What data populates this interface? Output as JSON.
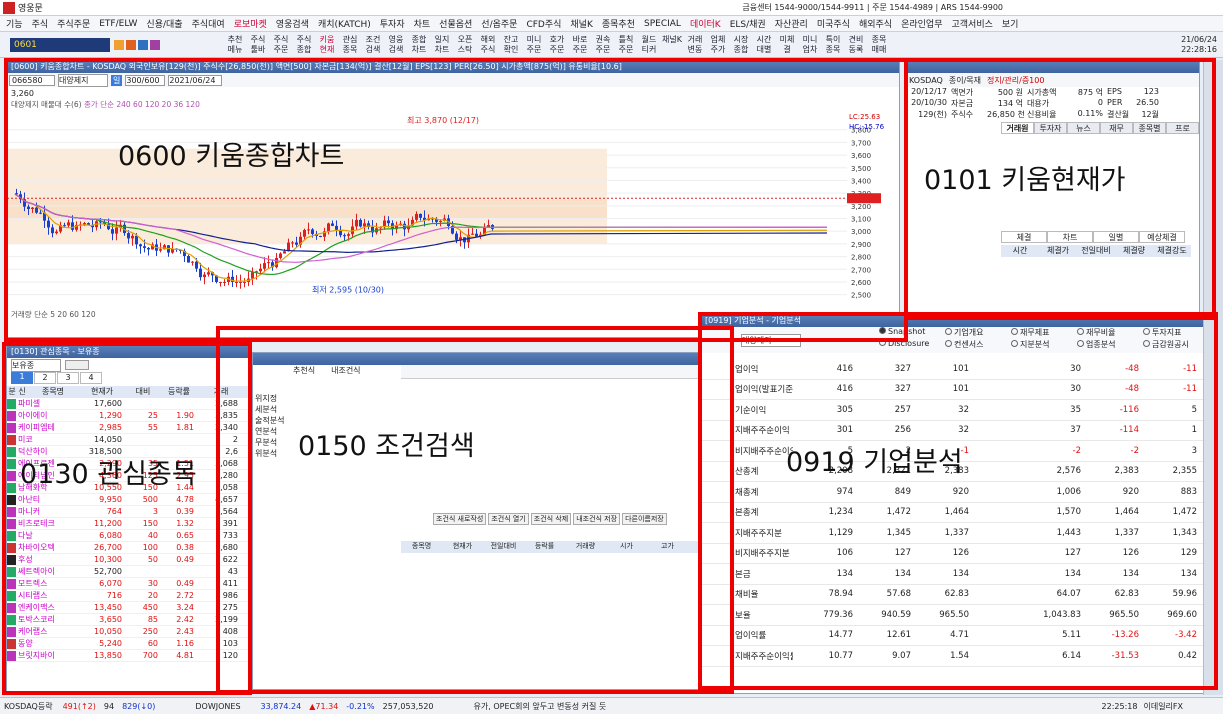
{
  "app": {
    "title": "영웅문",
    "center": "금융센터 1544-9000/1544-9911 | 주문 1544-4989 | ARS 1544-9900"
  },
  "menu": [
    "기능",
    "주식",
    "주식주문",
    "ETF/ELW",
    "신용/대출",
    "주식대여",
    "로보마켓",
    "영웅검색",
    "캐치(KATCH)",
    "투자자",
    "차트",
    "선물옵션",
    "선/옵주문",
    "CFD주식",
    "채널K",
    "종목추천",
    "SPECIAL",
    "데이터K",
    "ELS/채권",
    "자산관리",
    "미국주식",
    "해외주식",
    "온라인업무",
    "고객서비스",
    "보기"
  ],
  "toolbar": {
    "account": "0601",
    "buttons": [
      "추천메뉴",
      "주식툴바",
      "주식주문",
      "주식종합",
      "키움현재",
      "관심종목",
      "조건검색",
      "영웅검색",
      "종합차트",
      "일지차트",
      "오픈스탁",
      "해외주식",
      "잔고확인",
      "미니주문",
      "호가주문",
      "바로주문",
      "권속주문",
      "틀칙주문",
      "월드티커",
      "채널K",
      "거래변동",
      "업체주가",
      "시장종합",
      "시간대별",
      "미체결",
      "미니업차",
      "특이종목",
      "견비동록",
      "종목매매"
    ],
    "date": "21/06/24",
    "time": "22:28:16"
  },
  "chart": {
    "wtitle": "[0600] 키움종합차트 - KOSDAQ 외국인보유[129(천)] 주식수[26,850(천)] 액면[500] 자본금[134(억)] 결산[12월] EPS[123] PER[26.50] 시가총액[875(억)] 유통비율[10.6]",
    "code": "066580",
    "name": "대양제지",
    "period": "일",
    "count": "300/600",
    "date": "2021/06/24",
    "price": "3,260",
    "label": "0600 키움종합차트",
    "high_label": "최고 3,870 (12/17)",
    "low_label": "최저 2,595 (10/30)",
    "legend": "대양제지 매물대 수(6)",
    "ma": "종가 단순 240 60 120 20 36 120",
    "vol_label": "거래량 단순 5 20 60 120",
    "y_ticks": [
      "3,800",
      "3,700",
      "3,600",
      "3,500",
      "3,400",
      "3,300",
      "3,200",
      "3,100",
      "3,000",
      "2,900",
      "2,800",
      "2,700",
      "2,600",
      "2,500"
    ],
    "lc": "LC:25.63",
    "hc": "HC:-15.76"
  },
  "price": {
    "label": "0101 키움현재가",
    "code": "KOSDAQ",
    "sector": "종이/목재",
    "tags": "정지/관리/증100",
    "rows": [
      [
        "20/12/17",
        "액면가",
        "500 원",
        "시가총액",
        "875 억",
        "EPS",
        "123"
      ],
      [
        "20/10/30",
        "자본금",
        "134 억",
        "대용가",
        "0",
        "PER",
        "26.50"
      ],
      [
        "129(천)",
        "주식수",
        "26,850 천",
        "신용비율",
        "0.11%",
        "결산월",
        "12월"
      ]
    ],
    "tabs": [
      "거래원",
      "투자자",
      "뉴스",
      "재무",
      "종목별",
      "프로"
    ],
    "sub": [
      "체결",
      "차트",
      "일별",
      "예상체결"
    ],
    "cols": [
      "시간",
      "체결가",
      "전일대비",
      "체결량",
      "체결강도"
    ]
  },
  "watch": {
    "wtitle": "[0130] 관심종목 - 보유종",
    "label": "0130 관심종목",
    "group": "보유종",
    "headers": [
      "분",
      "신",
      "종목명",
      "현재가",
      "대비",
      "등락률",
      "거래"
    ],
    "rows": [
      [
        "파미셀",
        "17,600",
        "",
        "",
        "2,688"
      ],
      [
        "아이에이",
        "1,290",
        "25",
        "1.90",
        "3,835"
      ],
      [
        "케이피엠테",
        "2,985",
        "55",
        "1.81",
        "2,340"
      ],
      [
        "미코",
        "14,050",
        "",
        "",
        "2"
      ],
      [
        "덕산하이",
        "318,500",
        "",
        "",
        "2,6"
      ],
      [
        "에이프로젠",
        "2,290",
        "35",
        "1.51",
        "3,068"
      ],
      [
        "에이티넘인",
        "4,360",
        "125",
        "2.95",
        "1,280"
      ],
      [
        "남해화학",
        "10,550",
        "150",
        "1.44",
        "1,058"
      ],
      [
        "아난티",
        "9,950",
        "500",
        "4.78",
        "4,657"
      ],
      [
        "마니커",
        "764",
        "3",
        "0.39",
        "1,564"
      ],
      [
        "비츠로테크",
        "11,200",
        "150",
        "1.32",
        "391"
      ],
      [
        "다날",
        "6,080",
        "40",
        "0.65",
        "733"
      ],
      [
        "차바이오텍",
        "26,700",
        "100",
        "0.38",
        "1,680"
      ],
      [
        "후성",
        "10,300",
        "50",
        "0.49",
        "622"
      ],
      [
        "쎄트렉아이",
        "52,700",
        "",
        "",
        "43"
      ],
      [
        "모트렉스",
        "6,070",
        "30",
        "0.49",
        "411"
      ],
      [
        "시티랩스",
        "716",
        "20",
        "2.72",
        "986"
      ],
      [
        "엔케이맥스",
        "13,450",
        "450",
        "3.24",
        "275"
      ],
      [
        "토박스코리",
        "3,650",
        "85",
        "2.42",
        "2,199"
      ],
      [
        "케어랩스",
        "10,050",
        "250",
        "2.43",
        "408"
      ],
      [
        "동양",
        "5,240",
        "60",
        "1.16",
        "103"
      ],
      [
        "브릿지바이",
        "13,850",
        "700",
        "4.81",
        "120"
      ]
    ]
  },
  "cond": {
    "label": "0150 조건검색",
    "tabs": [
      "추천식",
      "내조건식"
    ],
    "tree": [
      "위지정",
      "세분석",
      "술적분석",
      "연분석",
      "무분석",
      "위분석"
    ],
    "btns": [
      "조건식 새로작성",
      "조건식 열기",
      "조건식 삭제",
      "내조건식 저장",
      "다른이름저장"
    ],
    "cols": [
      "종목명",
      "현재가",
      "전일대비",
      "등락률",
      "거래량",
      "시가",
      "고가",
      "저가"
    ]
  },
  "corp": {
    "wtitle": "[0919] 기업분석 - 기업분석",
    "label": "0919 기업분석",
    "name": "대양제지",
    "radios": [
      "Snapshot",
      "기업개요",
      "재무제표",
      "재무비율",
      "투자지표",
      "Disclosure",
      "컨센서스",
      "지분분석",
      "업종분석",
      "금감원공시"
    ],
    "rows": [
      [
        "업이익",
        "416",
        "327",
        "101",
        "30",
        "-48",
        "-11"
      ],
      [
        "업이익(발표기준)",
        "416",
        "327",
        "101",
        "30",
        "-48",
        "-11"
      ],
      [
        "기순이익",
        "305",
        "257",
        "32",
        "35",
        "-116",
        "5"
      ],
      [
        "지배주주순이익",
        "301",
        "256",
        "32",
        "37",
        "-114",
        "1"
      ],
      [
        "비지배주주순이익",
        "5",
        "2",
        "-1",
        "-2",
        "-2",
        "3"
      ],
      [
        "산총계",
        "2,208",
        "2,321",
        "2,383",
        "2,576",
        "2,383",
        "2,355"
      ],
      [
        "채총계",
        "974",
        "849",
        "920",
        "1,006",
        "920",
        "883"
      ],
      [
        "본총계",
        "1,234",
        "1,472",
        "1,464",
        "1,570",
        "1,464",
        "1,472"
      ],
      [
        "지배주주지분",
        "1,129",
        "1,345",
        "1,337",
        "1,443",
        "1,337",
        "1,343"
      ],
      [
        "비지배주주지분",
        "106",
        "127",
        "126",
        "127",
        "126",
        "129"
      ],
      [
        "본금",
        "134",
        "134",
        "134",
        "134",
        "134",
        "134"
      ],
      [
        "채비율",
        "78.94",
        "57.68",
        "62.83",
        "64.07",
        "62.83",
        "59.96"
      ],
      [
        "보율",
        "779.36",
        "940.59",
        "965.50",
        "1,043.83",
        "965.50",
        "969.60"
      ],
      [
        "업이익률",
        "14.77",
        "12.61",
        "4.71",
        "5.11",
        "-13.26",
        "-3.42"
      ],
      [
        "지배주주순이익률",
        "10.77",
        "9.07",
        "1.54",
        "6.14",
        "-31.53",
        "0.42"
      ]
    ]
  },
  "status": {
    "left": "KOSDAQ등락",
    "up": "491(↑2)",
    "flat": "94",
    "down": "829(↓0)",
    "idx": "DOWJONES",
    "v1": "33,874.24",
    "v2": "▲71.34",
    "v3": "-0.21%",
    "v4": "257,053,520",
    "news": "유가, OPEC회의 앞두고 변동성 커질 듯",
    "clock": "22:25:18",
    "brand": "이데일리FX"
  }
}
